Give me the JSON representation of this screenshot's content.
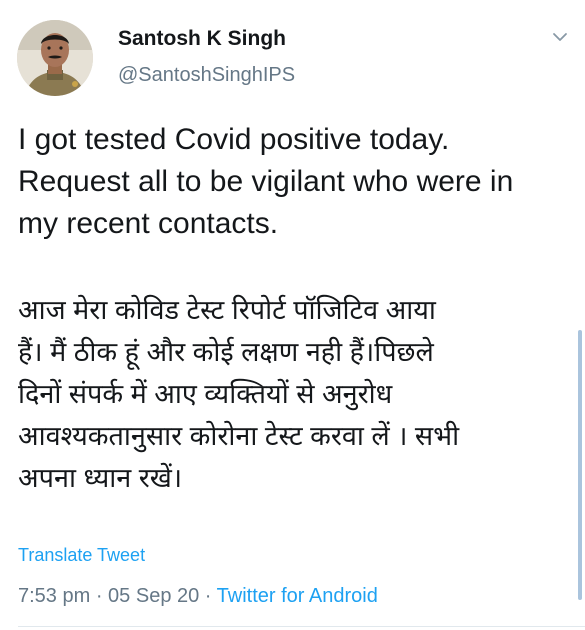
{
  "tweet": {
    "author": {
      "display_name": "Santosh K Singh",
      "handle": "@SantoshSinghIPS"
    },
    "text_en": "I got tested Covid positive today.\nRequest all to be vigilant who were in\nmy recent contacts.",
    "text_hi": "आज मेरा कोविड टेस्ट रिपोर्ट पॉजिटिव आया\nहैं। मैं ठीक हूं और कोई लक्षण नही हैं।पिछले\nदिनों संपर्क में आए व्यक्तियों से अनुरोध\nआवश्यकतानुसार कोरोना टेस्ट करवा लें । सभी\nअपना ध्यान रखें।",
    "translate_label": "Translate Tweet",
    "time": "7:53 pm",
    "separator": " · ",
    "date": "05 Sep 20",
    "source": "Twitter for Android"
  },
  "colors": {
    "link": "#1da1f2",
    "secondary_text": "#657786",
    "primary_text": "#14171a"
  },
  "icons": {
    "menu": "chevron-down-icon",
    "avatar": "user-avatar"
  }
}
